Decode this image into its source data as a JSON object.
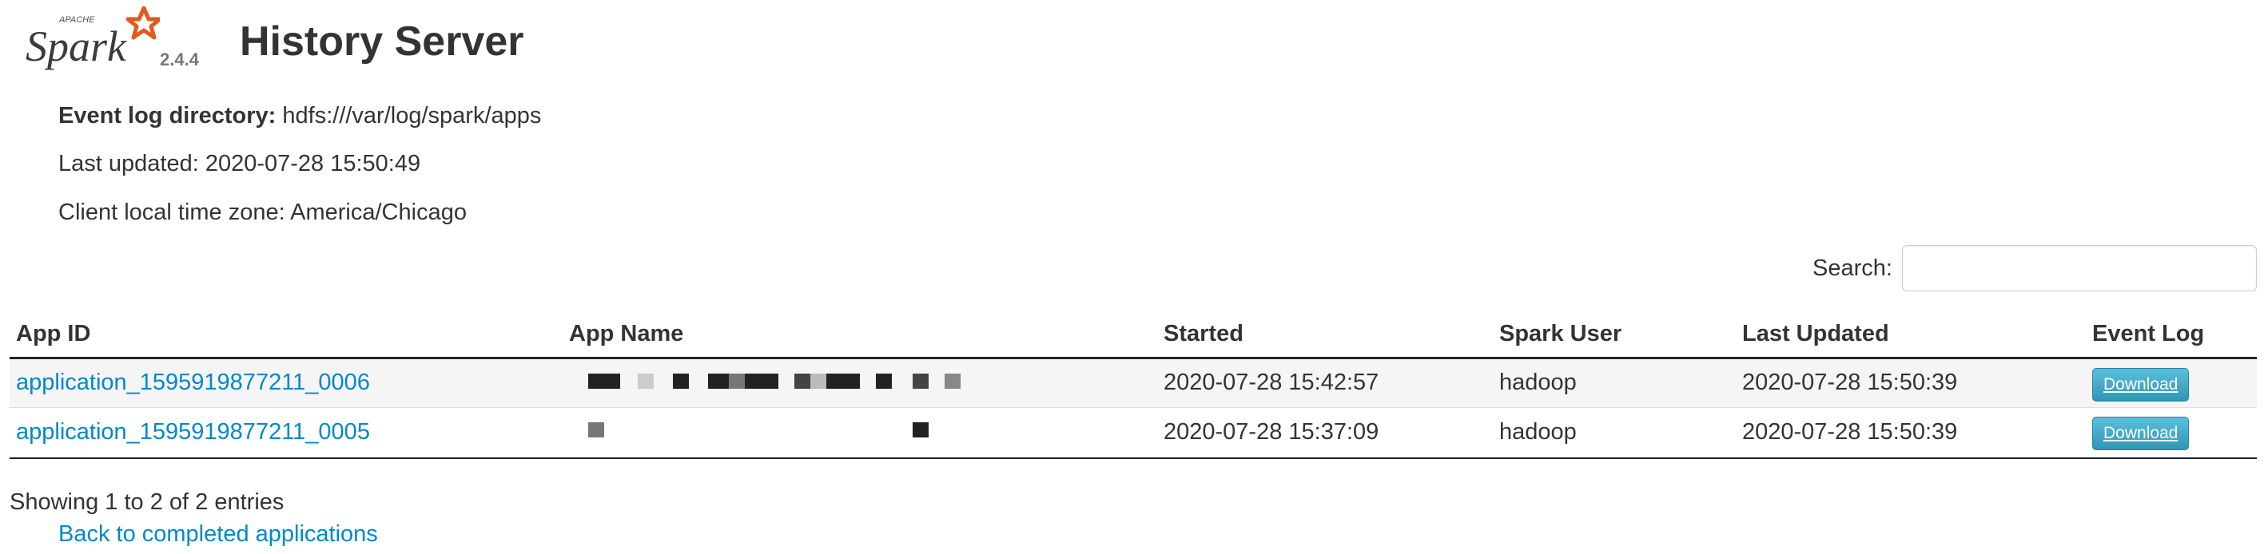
{
  "header": {
    "logo_text": "Spark",
    "logo_small_text": "APACHE",
    "version": "2.4.4",
    "title": "History Server"
  },
  "info": {
    "event_log_label": "Event log directory:",
    "event_log_value": "hdfs:///var/log/spark/apps",
    "last_updated": "Last updated: 2020-07-28 15:50:49",
    "time_zone": "Client local time zone: America/Chicago"
  },
  "search": {
    "label": "Search:",
    "value": ""
  },
  "table": {
    "columns": [
      "App ID",
      "App Name",
      "Started",
      "Spark User",
      "Last Updated",
      "Event Log"
    ],
    "rows": [
      {
        "app_id": "application_1595919877211_0006",
        "started": "2020-07-28 15:42:57",
        "user": "hadoop",
        "last_updated": "2020-07-28 15:50:39",
        "event_log": "Download"
      },
      {
        "app_id": "application_1595919877211_0005",
        "started": "2020-07-28 15:37:09",
        "user": "hadoop",
        "last_updated": "2020-07-28 15:50:39",
        "event_log": "Download"
      }
    ]
  },
  "footer": {
    "entries_info": "Showing 1 to 2 of 2 entries",
    "back_link": "Back to completed applications"
  },
  "colors": {
    "link": "#0088cc",
    "button": "#2f96b4",
    "logo_star": "#e25a1c"
  }
}
